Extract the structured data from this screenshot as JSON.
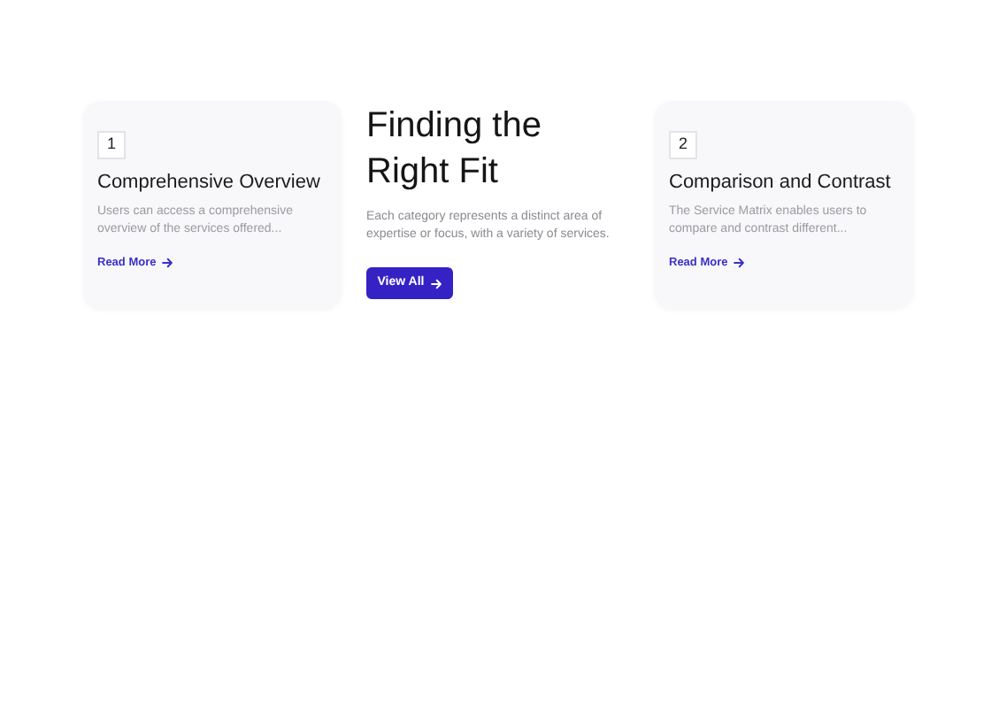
{
  "cards_left": [
    {
      "number": "1",
      "title": "Comprehensive Overview",
      "description": "Users can access a comprehensive overview of the services offered...",
      "link": "Read More"
    }
  ],
  "center": {
    "heading": "Finding the Right Fit",
    "description": "Each category represents a distinct area of expertise or focus, with a variety of services.",
    "button": "View All"
  },
  "cards_right": [
    {
      "number": "2",
      "title": "Comparison and Contrast",
      "description": "The Service Matrix enables users to compare and contrast different...",
      "link": "Read More"
    }
  ]
}
